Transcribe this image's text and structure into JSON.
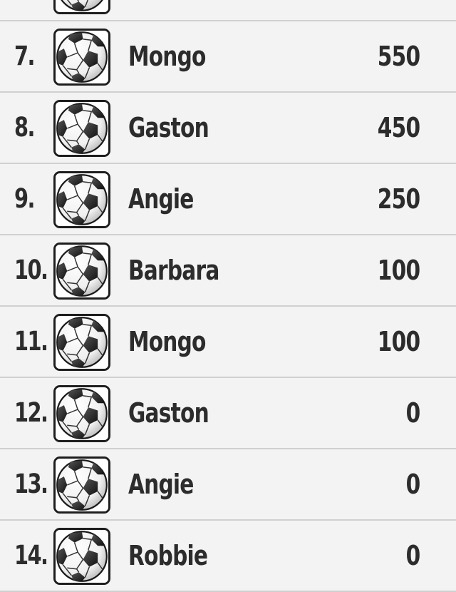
{
  "leaderboard": {
    "rows": [
      {
        "rank": "",
        "avatar_icon": "soccer-ball-icon",
        "name": "",
        "score": ""
      },
      {
        "rank": "7.",
        "avatar_icon": "soccer-ball-icon",
        "name": "Mongo",
        "score": "550"
      },
      {
        "rank": "8.",
        "avatar_icon": "soccer-ball-icon",
        "name": "Gaston",
        "score": "450"
      },
      {
        "rank": "9.",
        "avatar_icon": "soccer-ball-icon",
        "name": "Angie",
        "score": "250"
      },
      {
        "rank": "10.",
        "avatar_icon": "soccer-ball-icon",
        "name": "Barbara",
        "score": "100"
      },
      {
        "rank": "11.",
        "avatar_icon": "soccer-ball-icon",
        "name": "Mongo",
        "score": "100"
      },
      {
        "rank": "12.",
        "avatar_icon": "soccer-ball-icon",
        "name": "Gaston",
        "score": "0"
      },
      {
        "rank": "13.",
        "avatar_icon": "soccer-ball-icon",
        "name": "Angie",
        "score": "0"
      },
      {
        "rank": "14.",
        "avatar_icon": "soccer-ball-icon",
        "name": "Robbie",
        "score": "0"
      }
    ]
  },
  "colors": {
    "background": "#f3f3f3",
    "divider": "#d0d0d0",
    "text": "#2c2c2c",
    "avatar_border": "#1e1e1e"
  }
}
